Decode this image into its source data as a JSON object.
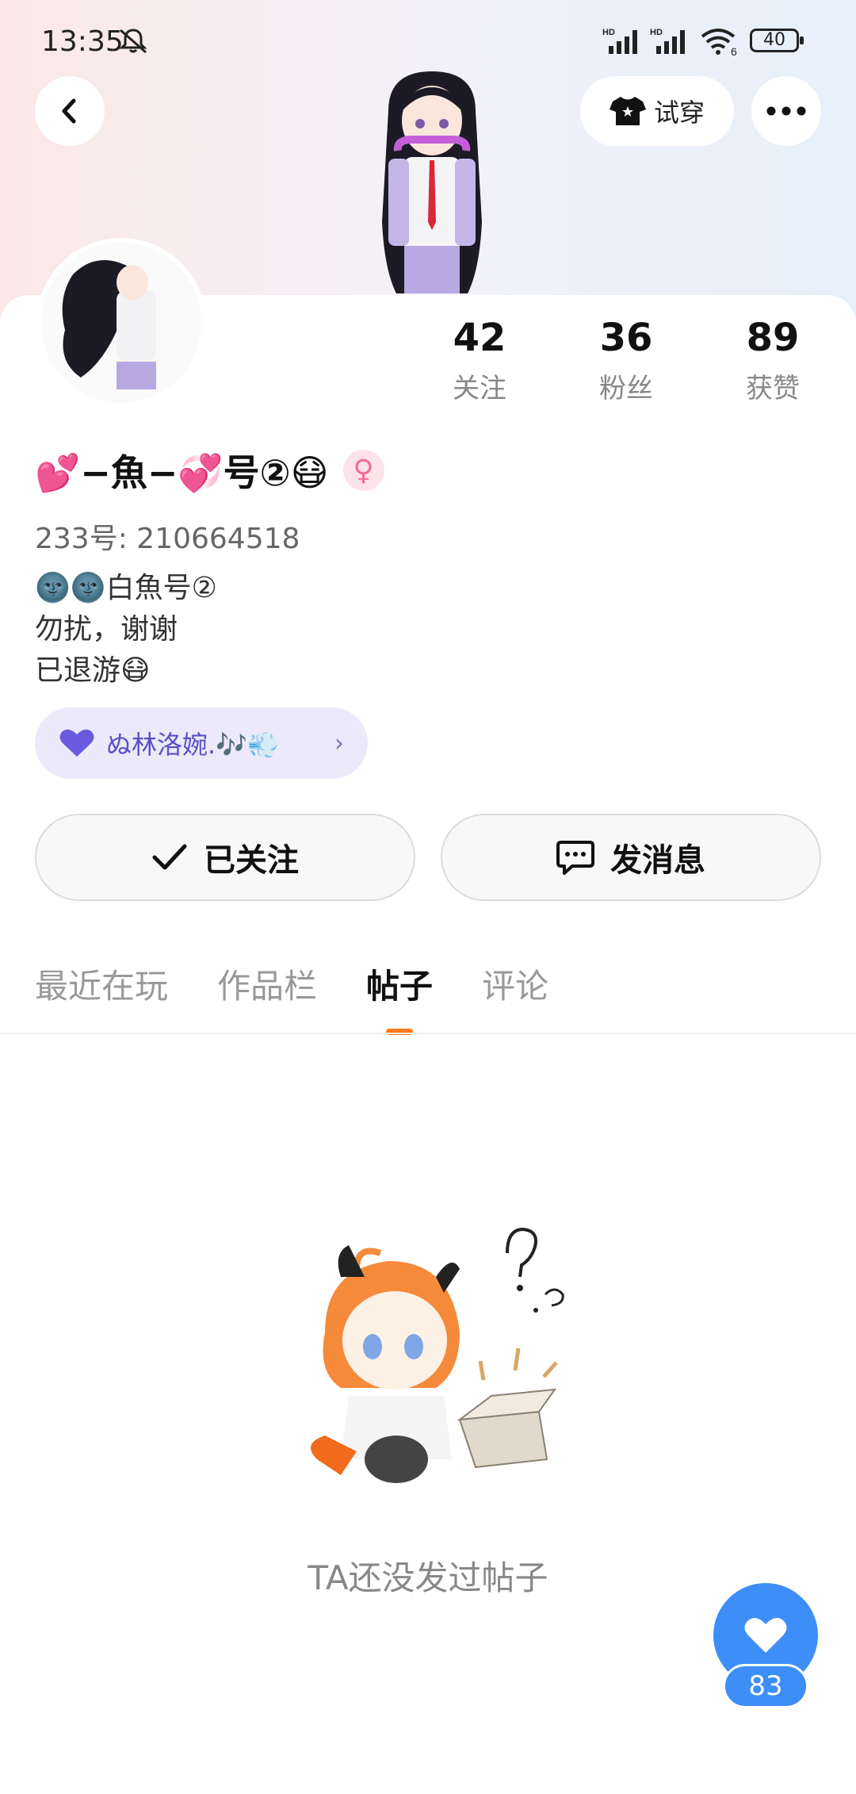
{
  "status_bar": {
    "time": "13:35",
    "battery": "40",
    "signal1": "HD",
    "signal2": "HD",
    "wifi": "6"
  },
  "header": {
    "try_on_label": "试穿"
  },
  "profile": {
    "nickname": "💕−魚−💞号②😷",
    "gender_symbol": "♀",
    "uid": "233号: 210664518",
    "bio": [
      "🌚🌚白魚号②",
      "勿扰，谢谢",
      "已退游😷"
    ],
    "guild_name": "ぬ林洛婉.🎶💨"
  },
  "stats": [
    {
      "value": "42",
      "label": "关注"
    },
    {
      "value": "36",
      "label": "粉丝"
    },
    {
      "value": "89",
      "label": "获赞"
    }
  ],
  "actions": {
    "follow_label": "已关注",
    "message_label": "发消息"
  },
  "tabs": [
    {
      "label": "最近在玩"
    },
    {
      "label": "作品栏"
    },
    {
      "label": "帖子"
    },
    {
      "label": "评论"
    }
  ],
  "empty_state": {
    "text": "TA还没发过帖子"
  },
  "like_fab": {
    "count": "83"
  },
  "colors": {
    "accent": "#ff7a1a",
    "fab": "#3d8ef7",
    "guild_bg": "#ece9fb",
    "guild_text": "#5b4fc8"
  }
}
